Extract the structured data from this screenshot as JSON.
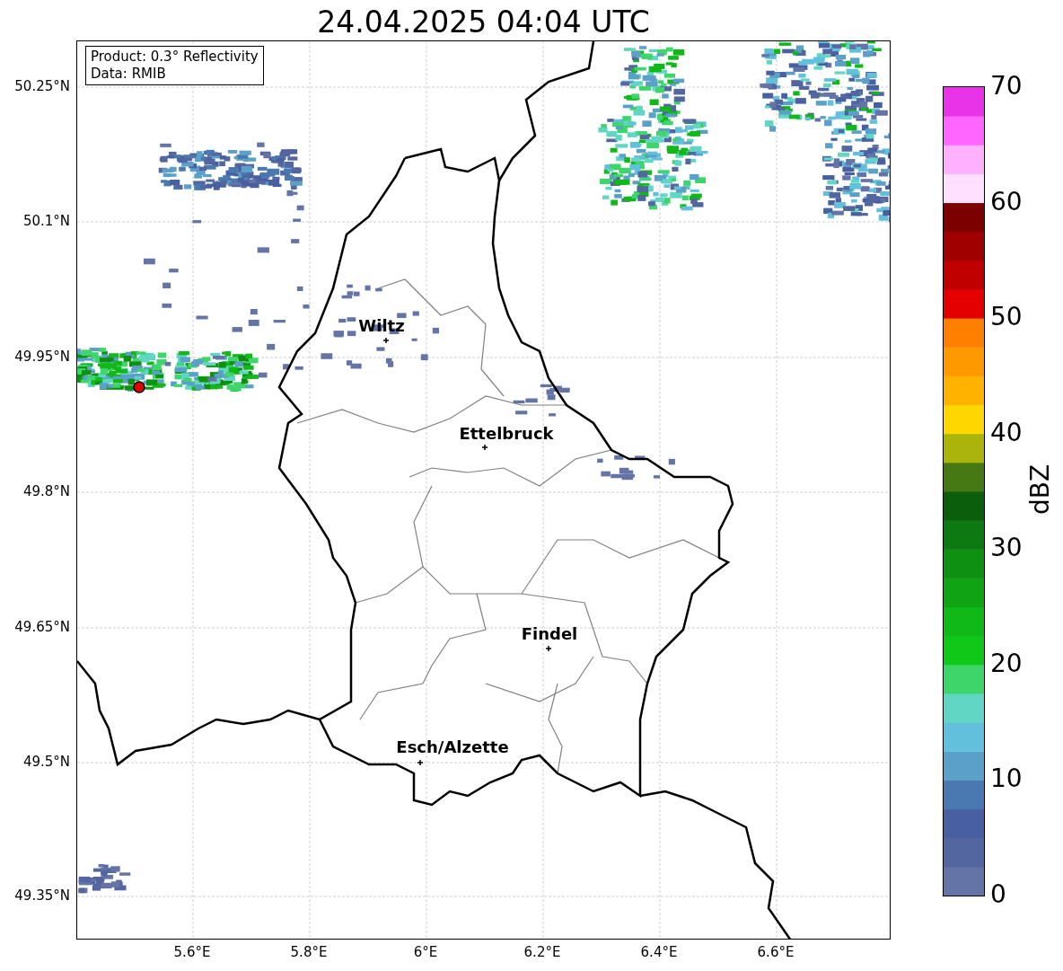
{
  "title": "24.04.2025 04:04 UTC",
  "info_box": {
    "lines": [
      "Product: 0.3° Reflectivity",
      "Data: RMIB"
    ]
  },
  "cities": [
    {
      "name": "Wiltz"
    },
    {
      "name": "Ettelbruck"
    },
    {
      "name": "Findel"
    },
    {
      "name": "Esch/Alzette"
    }
  ],
  "lat_ticks": [
    "50.25°N",
    "50.1°N",
    "49.95°N",
    "49.8°N",
    "49.65°N",
    "49.5°N",
    "49.35°N"
  ],
  "lon_ticks": [
    "5.6°E",
    "5.8°E",
    "6°E",
    "6.2°E",
    "6.4°E",
    "6.6°E"
  ],
  "colorbar": {
    "label": "dBZ",
    "ticks": [
      "70",
      "60",
      "50",
      "40",
      "30",
      "20",
      "10",
      "0"
    ],
    "bins": [
      {
        "color": "#6474a6"
      },
      {
        "color": "#5466a0"
      },
      {
        "color": "#4860a2"
      },
      {
        "color": "#4a78b0"
      },
      {
        "color": "#5aa0c8"
      },
      {
        "color": "#62c0dc"
      },
      {
        "color": "#62d6c4"
      },
      {
        "color": "#3ed66a"
      },
      {
        "color": "#10c818"
      },
      {
        "color": "#10b818"
      },
      {
        "color": "#10a414"
      },
      {
        "color": "#0e9012"
      },
      {
        "color": "#0c7a10"
      },
      {
        "color": "#0a5e0c"
      },
      {
        "color": "#467814"
      },
      {
        "color": "#aab40a"
      },
      {
        "color": "#ffd700"
      },
      {
        "color": "#ffb300"
      },
      {
        "color": "#ff9900"
      },
      {
        "color": "#ff7f00"
      },
      {
        "color": "#e40000"
      },
      {
        "color": "#c00000"
      },
      {
        "color": "#a00000"
      },
      {
        "color": "#7c0000"
      },
      {
        "color": "#ffe0ff"
      },
      {
        "color": "#ffb0ff"
      },
      {
        "color": "#ff66ff"
      },
      {
        "color": "#e833e8"
      }
    ]
  }
}
